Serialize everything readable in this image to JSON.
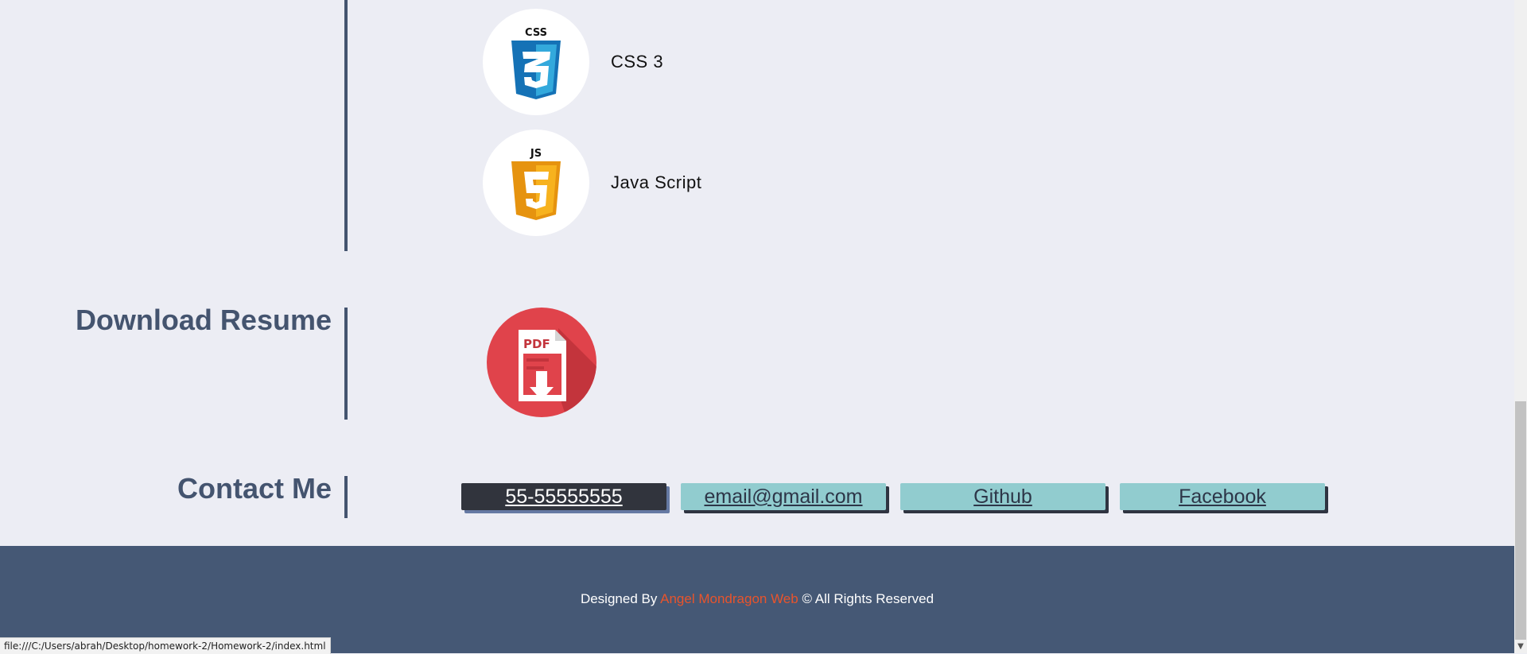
{
  "skills": {
    "items": [
      {
        "label": "CSS 3",
        "icon": "css3-icon",
        "badge_text": "CSS"
      },
      {
        "label": "Java Script",
        "icon": "javascript-icon",
        "badge_text": "JS"
      }
    ]
  },
  "resume": {
    "title": "Download Resume",
    "icon": "pdf-download-icon",
    "icon_text": "PDF"
  },
  "contact": {
    "title": "Contact Me",
    "buttons": [
      {
        "label": "55-55555555"
      },
      {
        "label": "email@gmail.com"
      },
      {
        "label": "Github"
      },
      {
        "label": "Facebook"
      }
    ]
  },
  "footer": {
    "prefix": "Designed By ",
    "brand": "Angel Mondragon Web",
    "suffix": " © All Rights Reserved"
  },
  "status_bar": {
    "url": "file:///C:/Users/abrah/Desktop/homework-2/Homework-2/index.html"
  },
  "colors": {
    "background": "#ecedf4",
    "heading": "#44546f",
    "contact_button": "#91cccf",
    "contact_button_active": "#31343d",
    "footer_bg": "#455875",
    "footer_brand": "#e8542c",
    "pdf_red": "#e0434b"
  }
}
